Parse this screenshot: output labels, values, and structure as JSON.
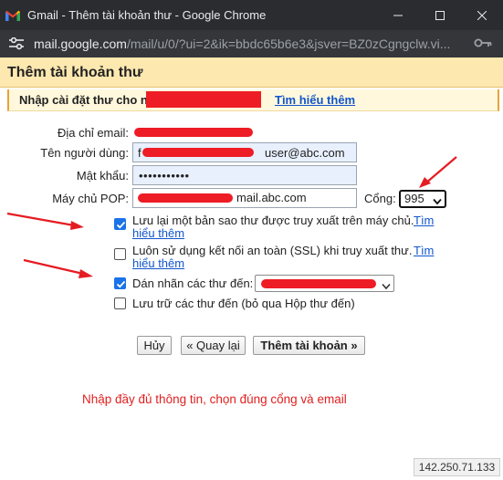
{
  "window": {
    "title": "Gmail - Thêm tài khoản thư - Google Chrome",
    "url_host": "mail.google.com",
    "url_path": "/mail/u/0/?ui=2&ik=bbdc65b6e3&jsver=BZ0zCgngclw.vi..."
  },
  "header": {
    "title": "Thêm tài khoản thư"
  },
  "instruction": {
    "text": "Nhập cài đặt thư cho n",
    "learn_more": "Tìm hiểu thêm"
  },
  "form": {
    "email_label": "Địa chỉ email:",
    "username_label": "Tên người dùng:",
    "username_value": "user@abc.com",
    "username_prefix": "f",
    "password_label": "Mật khẩu:",
    "password_value": "•••••••••••",
    "pop_label": "Máy chủ POP:",
    "pop_value": "mail.abc.com",
    "port_label": "Cổng:",
    "port_value": "995"
  },
  "options": {
    "leave_copy": {
      "label": "Lưu lại một bản sao thư được truy xuất trên máy chủ.",
      "link_part1": "Tìm",
      "link_part2": "hiểu thêm",
      "checked": true
    },
    "ssl": {
      "label": "Luôn sử dụng kết nối an toàn (SSL) khi truy xuất thư.",
      "link_part1": "Tìm",
      "link_part2": "hiểu thêm",
      "checked": false
    },
    "label_incoming": {
      "label": "Dán nhãn các thư đến:",
      "checked": true
    },
    "archive": {
      "label": "Lưu trữ các thư đến (bỏ qua Hộp thư đến)",
      "checked": false
    }
  },
  "buttons": {
    "cancel": "Hủy",
    "back": "« Quay lại",
    "add_account": "Thêm tài khoản »"
  },
  "note": "Nhập đầy đủ thông tin, chọn đúng cổng và email",
  "ip": "142.250.71.133",
  "colors": {
    "titlebar": "#2b2c30",
    "header_bg": "#fde8b0",
    "link": "#1155cc",
    "annotation_red": "#e02020",
    "checkbox_blue": "#1a73e8"
  }
}
